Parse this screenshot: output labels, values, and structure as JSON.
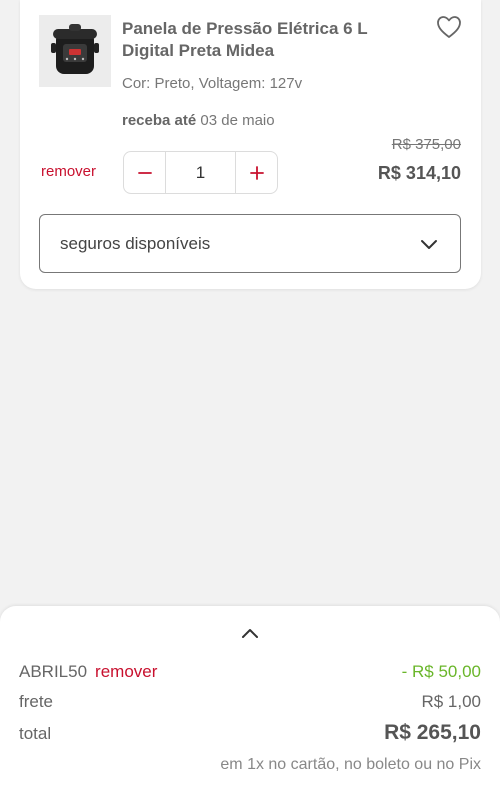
{
  "product": {
    "title": "Panela de Pressão Elétrica 6 L Digital Preta Midea",
    "variant": "Cor: Preto, Voltagem: 127v",
    "delivery_label": "receba até",
    "delivery_date": "03 de maio",
    "old_price": "R$ 375,00",
    "price": "R$ 314,10",
    "remove_label": "remover",
    "quantity": "1",
    "insurance_label": "seguros disponíveis"
  },
  "summary": {
    "coupon_code": "ABRIL50",
    "coupon_remove_label": "remover",
    "discount": "- R$ 50,00",
    "freight_label": "frete",
    "freight_value": "R$ 1,00",
    "total_label": "total",
    "total_value": "R$ 265,10",
    "payment_note": "em 1x no cartão, no boleto ou no Pix"
  },
  "colors": {
    "accent": "#c8102e",
    "discount": "#6ab62a"
  },
  "icons": [
    "pressure-cooker-image",
    "heart-icon",
    "minus-icon",
    "plus-icon",
    "chevron-down-icon",
    "chevron-up-icon"
  ]
}
